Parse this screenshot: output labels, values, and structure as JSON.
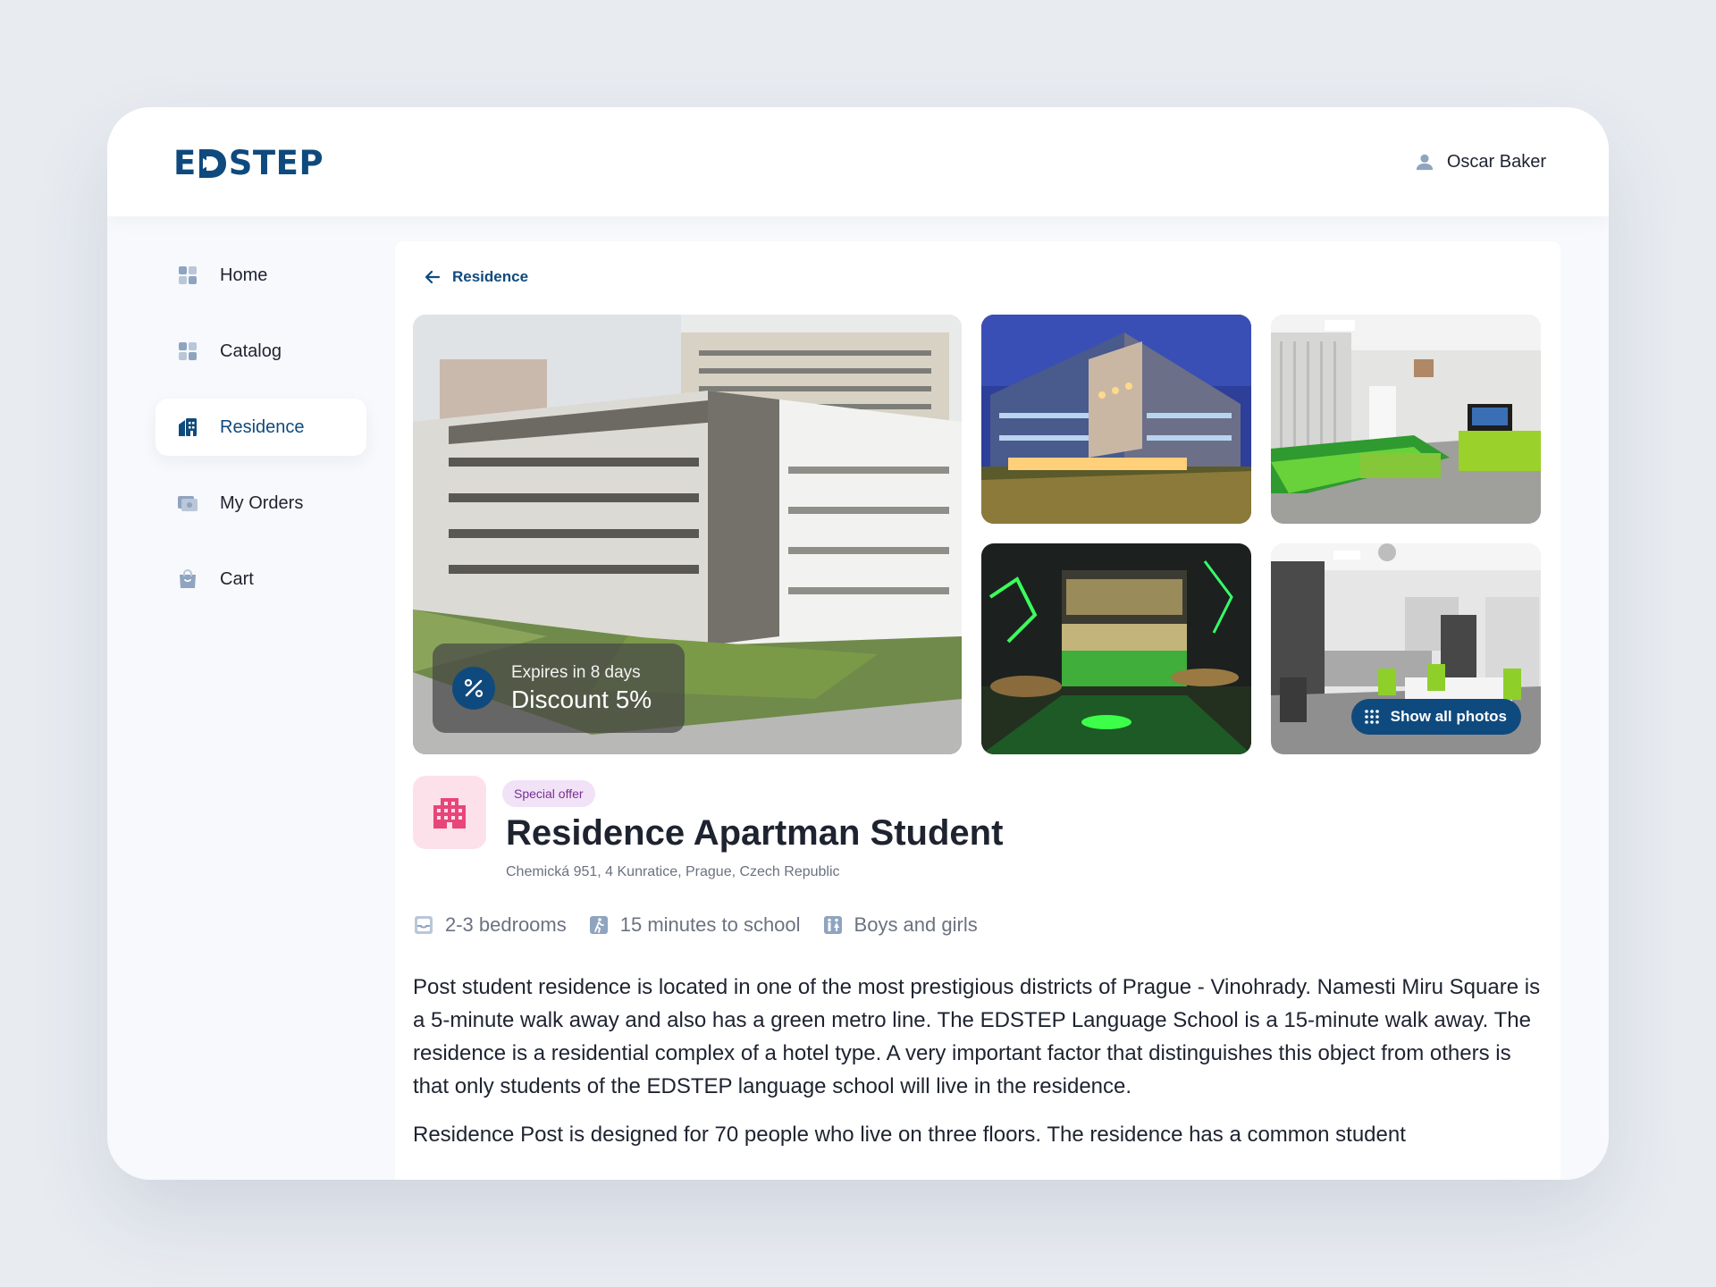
{
  "app": {
    "logo_text_left": "E",
    "logo_text_right": "STEP",
    "brand_color": "#0f4a7e",
    "user_name": "Oscar Baker"
  },
  "sidebar": {
    "items": [
      {
        "label": "Home",
        "icon": "grid-icon",
        "active": false
      },
      {
        "label": "Catalog",
        "icon": "grid-icon",
        "active": false
      },
      {
        "label": "Residence",
        "icon": "building-icon",
        "active": true
      },
      {
        "label": "My Orders",
        "icon": "orders-icon",
        "active": false
      },
      {
        "label": "Cart",
        "icon": "bag-icon",
        "active": false
      }
    ]
  },
  "main": {
    "back_label": "Residence",
    "gallery": {
      "discount_expiry": "Expires in 8 days",
      "discount_value": "Discount 5%",
      "show_all_label": "Show all photos"
    },
    "badge": "Special offer",
    "title": "Residence Apartman Student",
    "address": "Chemická 951, 4 Kunratice, Prague, Czech Republic",
    "features": [
      {
        "icon": "bed-icon",
        "label": "2-3 bedrooms"
      },
      {
        "icon": "walk-icon",
        "label": "15 minutes to school"
      },
      {
        "icon": "gender-icon",
        "label": "Boys and girls"
      }
    ],
    "description": [
      "Post student residence is located in one of the most prestigious districts of Prague - Vinohrady. Namesti Miru Square is a 5-minute walk away and also has a green metro line. The EDSTEP Language School is a 15-minute walk away. The residence is a residential complex of a hotel type. A very important factor that distinguishes this object from others is that only students of the EDSTEP language school will live in the residence.",
      "Residence Post is designed for 70 people who live on three floors. The residence has a common student"
    ]
  },
  "colors": {
    "accent": "#0f4a7e",
    "badge_bg": "#f1e2f7",
    "badge_text": "#7b2e93",
    "icon_pink": "#e8457a",
    "nav_icon": "#8fa4bf"
  }
}
